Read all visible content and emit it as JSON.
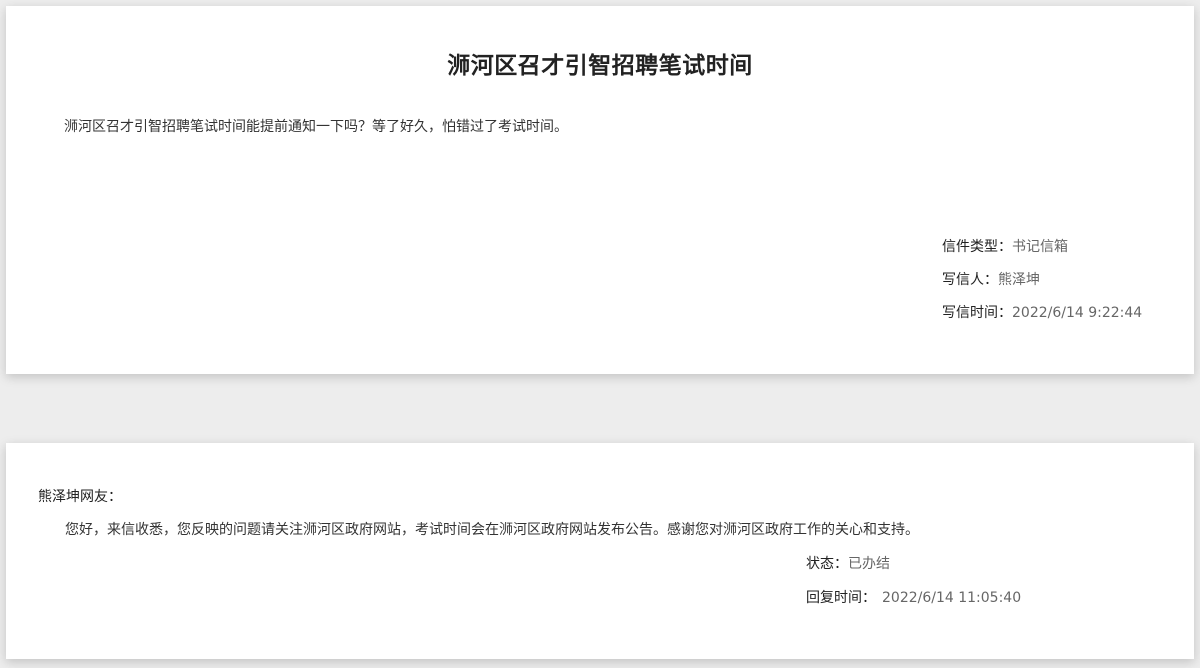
{
  "letter": {
    "title": "浉河区召才引智招聘笔试时间",
    "content": "浉河区召才引智招聘笔试时间能提前通知一下吗？等了好久，怕错过了考试时间。",
    "type_label": "信件类型：",
    "type_value": "书记信箱",
    "writer_label": "写信人：",
    "writer_value": "熊泽坤",
    "time_label": "写信时间：",
    "time_value": "2022/6/14 9:22:44"
  },
  "reply": {
    "salutation": "熊泽坤网友：",
    "content": "您好，来信收悉，您反映的问题请关注浉河区政府网站，考试时间会在浉河区政府网站发布公告。感谢您对浉河区政府工作的关心和支持。",
    "status_label": "状态：",
    "status_value": "已办结",
    "time_label": "回复时间：",
    "time_value": "2022/6/14 11:05:40"
  }
}
